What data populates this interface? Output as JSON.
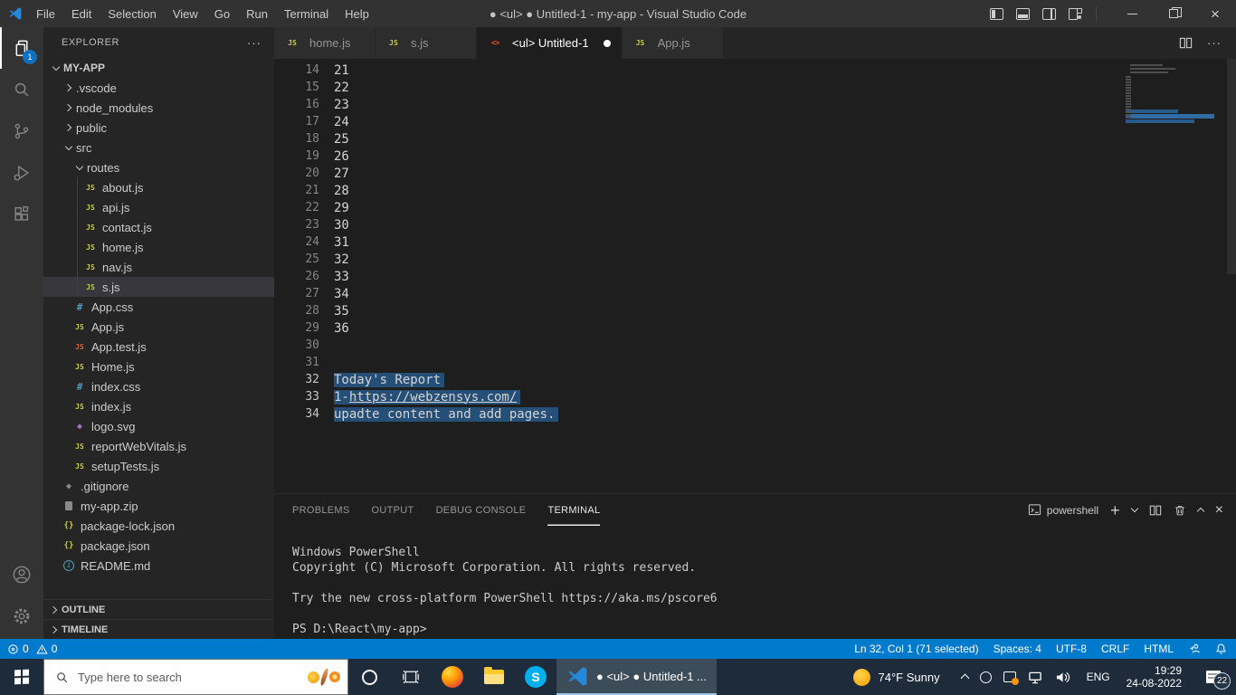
{
  "window": {
    "title": "● <ul> ● Untitled-1 - my-app - Visual Studio Code",
    "controls": [
      "minimize",
      "restore",
      "close"
    ],
    "layout_icons": [
      "toggle-sidebar",
      "toggle-panel",
      "toggle-secondary-sidebar",
      "customize-layout"
    ]
  },
  "menu_bar": {
    "menus": [
      "File",
      "Edit",
      "Selection",
      "View",
      "Go",
      "Run",
      "Terminal",
      "Help"
    ]
  },
  "activity_bar": {
    "items": [
      "explorer",
      "search",
      "source-control",
      "run-and-debug",
      "extensions"
    ],
    "active_item": "explorer",
    "explorer_badge": "1",
    "bottom_items": [
      "account",
      "settings"
    ]
  },
  "sidebar": {
    "header": "EXPLORER",
    "header_action": "more-actions",
    "root": "MY-APP",
    "tree": [
      {
        "label": ".vscode",
        "indent": 1,
        "chevron": "right",
        "icon": ""
      },
      {
        "label": "node_modules",
        "indent": 1,
        "chevron": "right",
        "icon": ""
      },
      {
        "label": "public",
        "indent": 1,
        "chevron": "right",
        "icon": ""
      },
      {
        "label": "src",
        "indent": 1,
        "chevron": "down",
        "icon": ""
      },
      {
        "label": "routes",
        "indent": 2,
        "chevron": "down",
        "icon": ""
      },
      {
        "label": "about.js",
        "indent": 3,
        "icon": "js",
        "guide": true
      },
      {
        "label": "api.js",
        "indent": 3,
        "icon": "js",
        "guide": true
      },
      {
        "label": "contact.js",
        "indent": 3,
        "icon": "js",
        "guide": true
      },
      {
        "label": "home.js",
        "indent": 3,
        "icon": "js",
        "guide": true
      },
      {
        "label": "nav.js",
        "indent": 3,
        "icon": "js",
        "guide": true
      },
      {
        "label": "s.js",
        "indent": 3,
        "icon": "js",
        "guide": true,
        "selected": true
      },
      {
        "label": "App.css",
        "indent": 2,
        "icon": "css"
      },
      {
        "label": "App.js",
        "indent": 2,
        "icon": "js"
      },
      {
        "label": "App.test.js",
        "indent": 2,
        "icon": "js-test"
      },
      {
        "label": "Home.js",
        "indent": 2,
        "icon": "js"
      },
      {
        "label": "index.css",
        "indent": 2,
        "icon": "css"
      },
      {
        "label": "index.js",
        "indent": 2,
        "icon": "js"
      },
      {
        "label": "logo.svg",
        "indent": 2,
        "icon": "svg"
      },
      {
        "label": "reportWebVitals.js",
        "indent": 2,
        "icon": "js"
      },
      {
        "label": "setupTests.js",
        "indent": 2,
        "icon": "js"
      },
      {
        "label": ".gitignore",
        "indent": 1,
        "icon": "git"
      },
      {
        "label": "my-app.zip",
        "indent": 1,
        "icon": "zip"
      },
      {
        "label": "package-lock.json",
        "indent": 1,
        "icon": "json"
      },
      {
        "label": "package.json",
        "indent": 1,
        "icon": "json"
      },
      {
        "label": "README.md",
        "indent": 1,
        "icon": "md"
      }
    ],
    "sections": [
      "OUTLINE",
      "TIMELINE"
    ]
  },
  "tabs": [
    {
      "label": "home.js",
      "icon": "js"
    },
    {
      "label": "s.js",
      "icon": "js"
    },
    {
      "label": "<ul> Untitled-1",
      "icon": "html",
      "active": true,
      "dirty": true
    },
    {
      "label": "App.js",
      "icon": "js"
    }
  ],
  "editor": {
    "lines": [
      {
        "num": 14,
        "text": "21"
      },
      {
        "num": 15,
        "text": "22"
      },
      {
        "num": 16,
        "text": "23"
      },
      {
        "num": 17,
        "text": "24"
      },
      {
        "num": 18,
        "text": "25"
      },
      {
        "num": 19,
        "text": "26"
      },
      {
        "num": 20,
        "text": "27"
      },
      {
        "num": 21,
        "text": "28"
      },
      {
        "num": 22,
        "text": "29"
      },
      {
        "num": 23,
        "text": "30"
      },
      {
        "num": 24,
        "text": "31"
      },
      {
        "num": 25,
        "text": "32"
      },
      {
        "num": 26,
        "text": "33"
      },
      {
        "num": 27,
        "text": "34"
      },
      {
        "num": 28,
        "text": "35"
      },
      {
        "num": 29,
        "text": "36"
      },
      {
        "num": 30,
        "text": ""
      },
      {
        "num": 31,
        "text": ""
      },
      {
        "num": 32,
        "text": "Today's Report",
        "selected": true
      },
      {
        "num": 33,
        "text": "1-",
        "link": "https://webzensys.com/",
        "selected": true
      },
      {
        "num": 34,
        "text": "upadte content and add pages.",
        "selected": true
      }
    ]
  },
  "panel": {
    "tabs": [
      "PROBLEMS",
      "OUTPUT",
      "DEBUG CONSOLE",
      "TERMINAL"
    ],
    "active_tab": "TERMINAL",
    "shell_label": "powershell",
    "action_icons": [
      "new-terminal",
      "launch-profile",
      "split-terminal",
      "kill-terminal",
      "maximize-panel",
      "close-panel"
    ],
    "terminal_lines": [
      "Windows PowerShell",
      "Copyright (C) Microsoft Corporation. All rights reserved.",
      "",
      "Try the new cross-platform PowerShell https://aka.ms/pscore6",
      "",
      "PS D:\\React\\my-app>"
    ]
  },
  "status_bar": {
    "errors": "0",
    "warnings": "0",
    "cursor": "Ln 32, Col 1 (71 selected)",
    "indentation": "Spaces: 4",
    "encoding": "UTF-8",
    "eol": "CRLF",
    "language": "HTML",
    "right_icons": [
      "feedback",
      "bell"
    ]
  },
  "taskbar": {
    "search_placeholder": "Type here to search",
    "pinned_apps": [
      "cortana",
      "task-view",
      "firefox",
      "file-explorer",
      "skype",
      "vscode"
    ],
    "vscode_button_label": "● <ul> ● Untitled-1 ...",
    "weather": "74°F Sunny",
    "tray_icons": [
      "chevron-up",
      "cortana-ring",
      "update-available",
      "network",
      "volume"
    ],
    "language": "ENG",
    "time": "19:29",
    "date": "24-08-2022",
    "notification_count": "22"
  },
  "colors": {
    "accent": "#007acc",
    "selection": "#264f78",
    "activity_badge": "#0e70c0",
    "taskbar": "#1d2b3a"
  }
}
